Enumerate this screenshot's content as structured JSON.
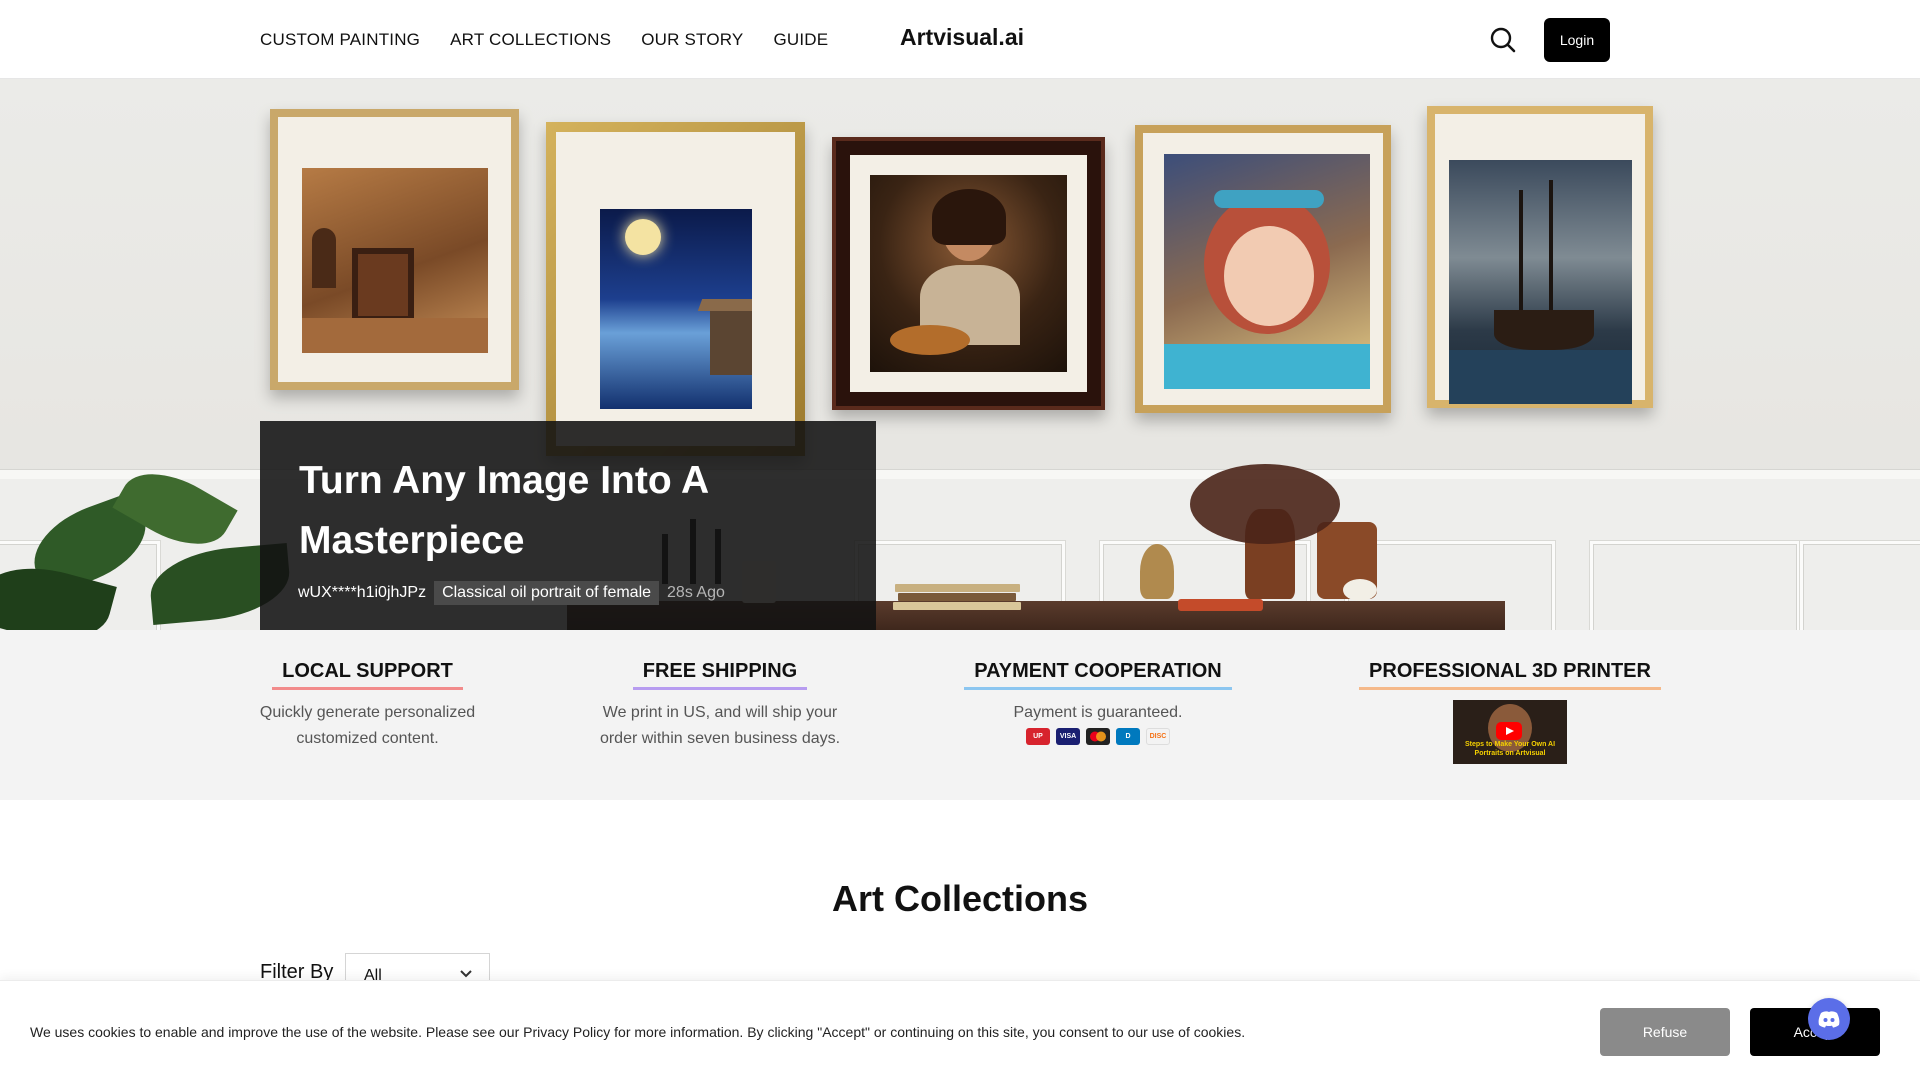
{
  "header": {
    "nav": [
      "CUSTOM PAINTING",
      "ART COLLECTIONS",
      "OUR STORY",
      "GUIDE"
    ],
    "logo": "Artvisual.ai",
    "login_label": "Login",
    "search_icon": "search-icon"
  },
  "hero": {
    "title": "Turn Any Image Into A Masterpiece",
    "user": "wUX****h1i0jhJPz",
    "tag": "Classical oil portrait of female",
    "time": "28s Ago"
  },
  "features": [
    {
      "title": "LOCAL SUPPORT",
      "desc": "Quickly generate personalized customized content.",
      "underline_color": "#f28b8b"
    },
    {
      "title": "FREE SHIPPING",
      "desc": "We print in US, and will ship your order within seven business days.",
      "underline_color": "#b79cf0"
    },
    {
      "title": "PAYMENT COOPERATION",
      "desc": "Payment is guaranteed.",
      "underline_color": "#8cc6f0"
    },
    {
      "title": "PROFESSIONAL 3D PRINTER",
      "desc": "",
      "underline_color": "#f5b98a",
      "video_caption": "Steps to Make Your Own AI Portraits on Artvisual"
    }
  ],
  "payment_icons": [
    {
      "name": "unionpay-icon",
      "label": "UP",
      "color": "#d7232d"
    },
    {
      "name": "visa-icon",
      "label": "VISA",
      "color": "#1a1f71"
    },
    {
      "name": "mastercard-icon",
      "label": "MC",
      "color": "#222222"
    },
    {
      "name": "diners-icon",
      "label": "D",
      "color": "#0079be"
    },
    {
      "name": "discover-icon",
      "label": "DISC",
      "color": "#f47216"
    }
  ],
  "collections": {
    "title": "Art Collections",
    "filter_label": "Filter By",
    "filter_value": "All"
  },
  "cookie": {
    "text": "We uses cookies to enable and improve the use of the website. Please see our Privacy Policy for more information. By clicking \"Accept\" or continuing on this site, you consent to our use of cookies.",
    "refuse_label": "Refuse",
    "accept_label": "Accept"
  },
  "colors": {
    "accent": "#000000",
    "discord": "#5b6ee8"
  }
}
